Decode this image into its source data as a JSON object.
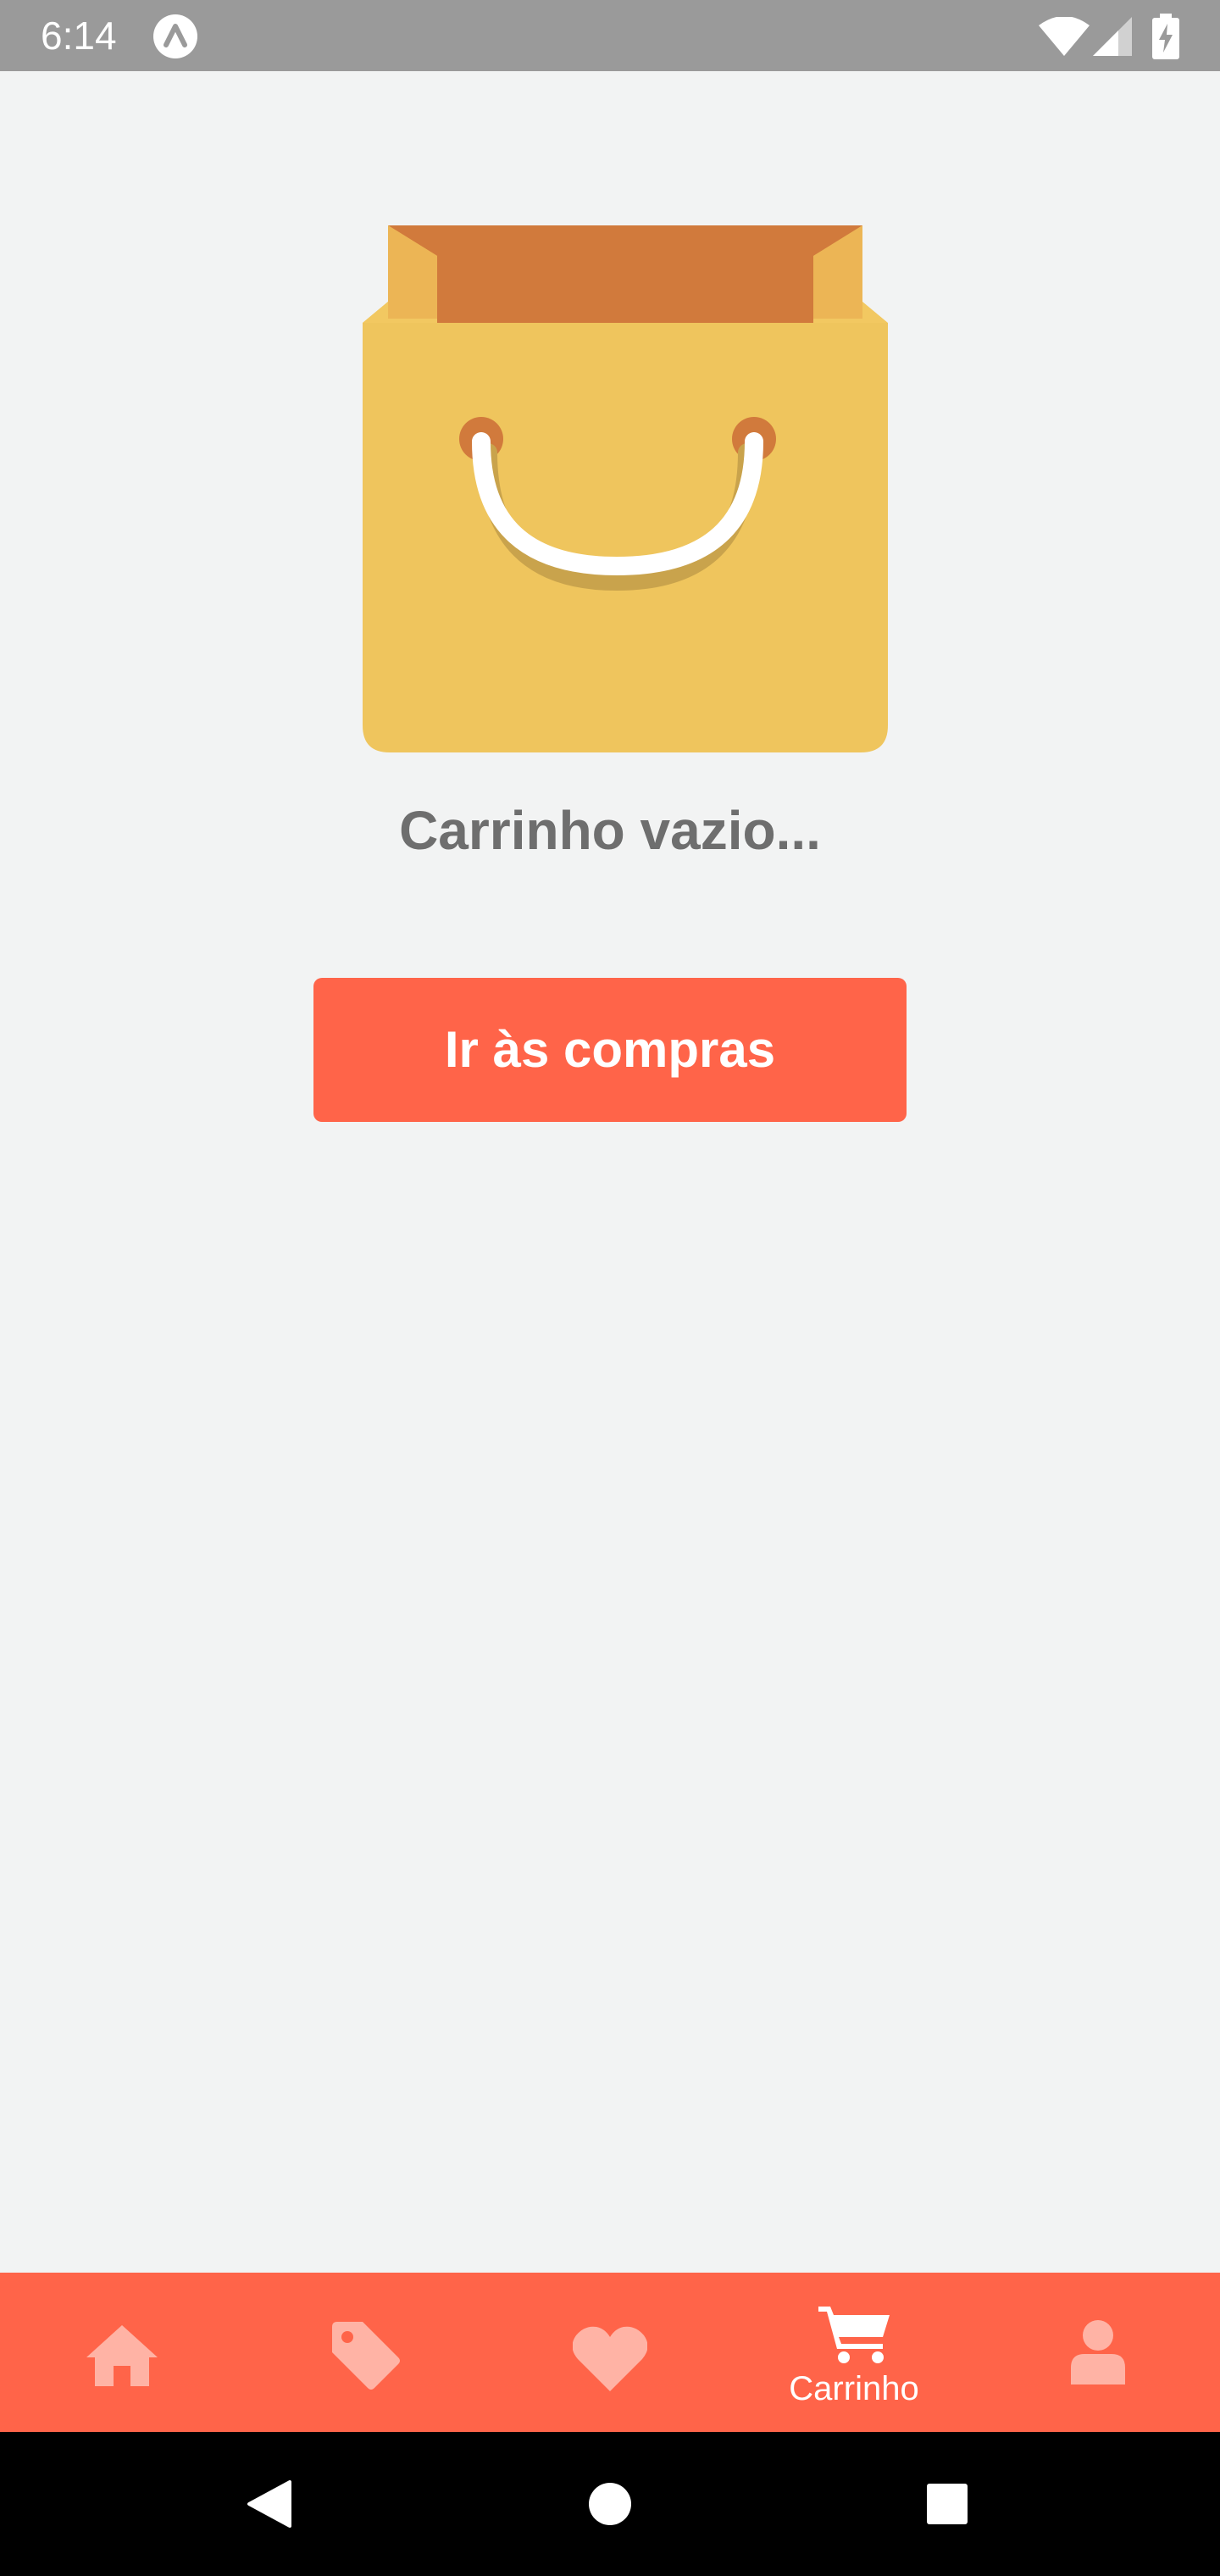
{
  "status_bar": {
    "time": "6:14",
    "app_icon": "expo-icon",
    "wifi_icon": "wifi-icon",
    "signal_icon": "signal-icon",
    "battery_icon": "battery-charging-icon"
  },
  "main": {
    "illustration": "shopping-bag-illustration",
    "empty_message": "Carrinho vazio...",
    "shop_button_label": "Ir às compras"
  },
  "tab_bar": {
    "tabs": [
      {
        "icon": "home-icon",
        "label": "",
        "active": false
      },
      {
        "icon": "tag-icon",
        "label": "",
        "active": false
      },
      {
        "icon": "heart-icon",
        "label": "",
        "active": false
      },
      {
        "icon": "cart-icon",
        "label": "Carrinho",
        "active": true
      },
      {
        "icon": "user-icon",
        "label": "",
        "active": false
      }
    ]
  },
  "nav_bar": {
    "back_icon": "back-triangle-icon",
    "home_icon": "home-circle-icon",
    "recents_icon": "recents-square-icon"
  },
  "colors": {
    "accent": "#ff6449",
    "background": "#f2f3f3",
    "status_bar": "#9a9a9a",
    "inactive_tab_icon": "#ffb3a5",
    "active_tab": "#ffffff",
    "bag_body": "#efc55d",
    "bag_inside": "#d17a3c",
    "message_text": "#6e6e6e"
  }
}
